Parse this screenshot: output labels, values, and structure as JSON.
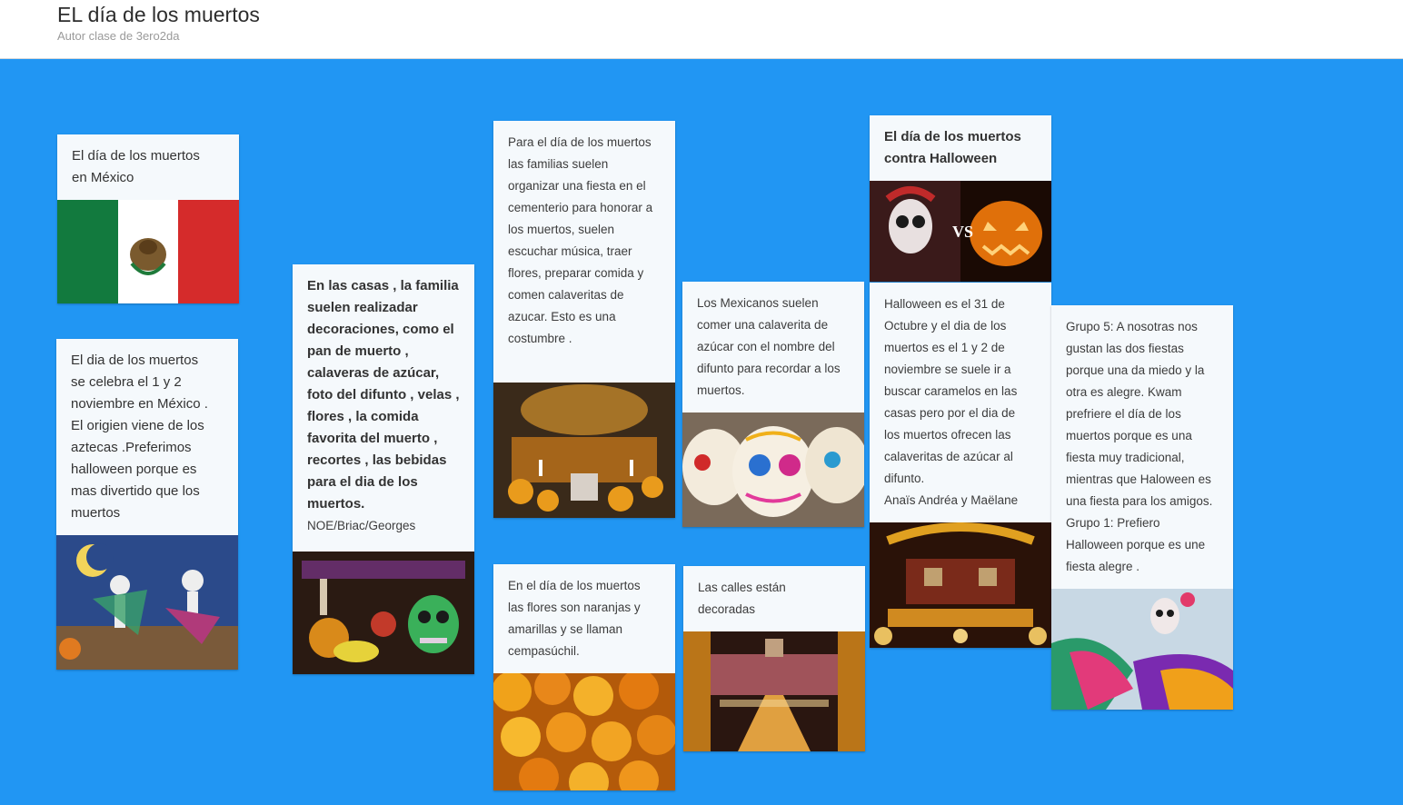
{
  "header": {
    "title": "EL día de los muertos",
    "subtitle": "Autor clase de 3ero2da"
  },
  "cards": [
    {
      "text": "El día de los muertos\nen México",
      "image": "mexican-flag"
    },
    {
      "text": "El dia de los muertos\nse celebra el 1 y 2\nnoviembre en México .\nEl origien viene de los\naztecas .Preferimos\nhalloween porque es\nmas divertido que los\nmuertos",
      "image": "skeletons-dancing-painting"
    },
    {
      "text": "En las casas , la familia\nsuelen realizadar\ndecoraciones, como el\npan de muerto ,\ncalaveras de azúcar,\nfoto del difunto , velas ,\nflores ,  la comida\nfavorita del muerto ,\nrecortes , las bebidas\npara el dia de los\nmuertos.",
      "author": "NOE/Briac/Georges",
      "image": "altar-fruit-skull"
    },
    {
      "text": "Para el día de los muertos\nlas familias suelen\norganizar una fiesta en el\ncementerio para honorar a\nlos muertos, suelen\nescuchar música, traer\nflores, preparar comida y\ncomen calaveritas de\nazucar. Esto  es una\ncostumbre .",
      "image": "cemetery-candles-flowers"
    },
    {
      "text": "En el día de los muertos\nlas flores son naranjas y\namarillas y se llaman\ncempasúchil.",
      "image": "marigold-flowers"
    },
    {
      "text": "Los Mexicanos suelen\ncomer una calaverita de\nazúcar con el nombre del\ndifunto para recordar a los\nmuertos.",
      "image": "sugar-skulls"
    },
    {
      "text": "Las calles están\ndecoradas",
      "image": "decorated-street"
    },
    {
      "text": "El día de los muertos\ncontra Halloween",
      "image": "catrina-vs-pumpkin",
      "vs_label": "VS"
    },
    {
      "text": "Halloween es el 31 de\nOctubre y el dia de los\nmuertos es el 1 y 2 de\nnoviembre se suele ir a\nbuscar caramelos en las\ncasas pero por el dia de\nlos muertos ofrecen las\ncalaveritas de azúcar al\ndifunto.\nAnaïs Andréa y Maëlane",
      "image": "altar-candles"
    },
    {
      "text": "Grupo 5: A nosotras nos\ngustan las dos fiestas\nporque una da miedo y la\notra es alegre.  Kwam\nprefriere el día de los\nmuertos porque es una\nfiesta muy tradicional,\nmientras que Haloween es\nuna fiesta para los amigos.\nGrupo 1: Prefiero\nHalloween porque es une\nfiesta alegre .",
      "image": "catrina-dancer"
    }
  ],
  "colors": {
    "background": "#2196f3",
    "card": "#f5f9fc",
    "header": "#ffffff"
  }
}
